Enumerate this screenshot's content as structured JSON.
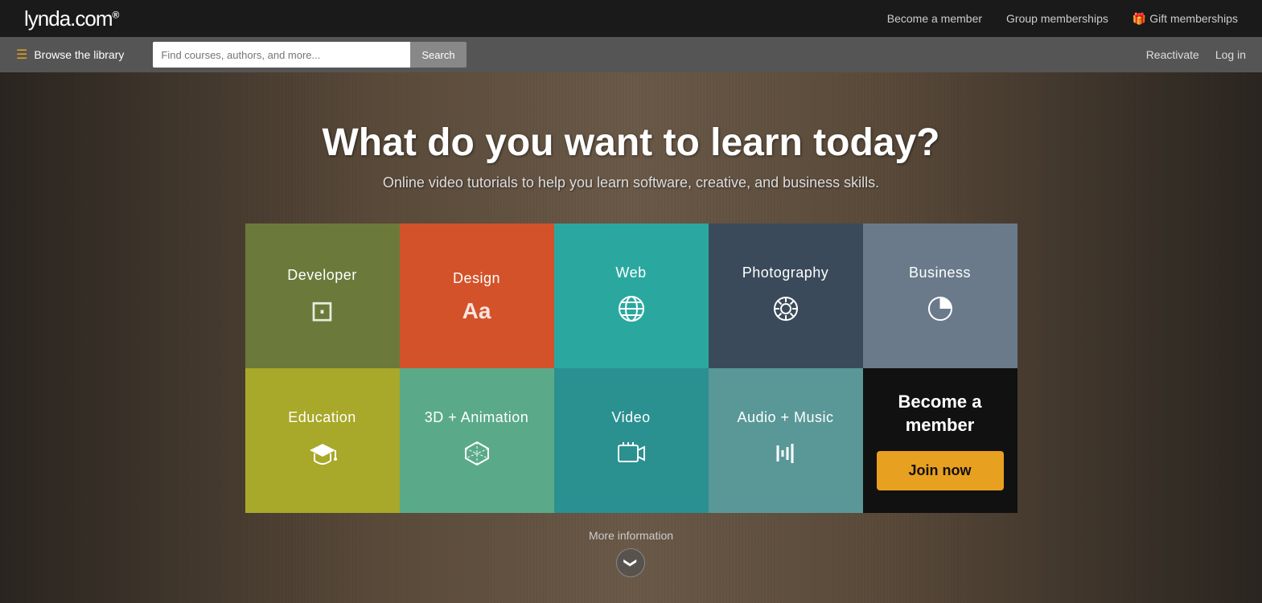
{
  "brand": {
    "name": "lynda",
    "tld": ".com",
    "trademark": "®"
  },
  "topnav": {
    "become_member": "Become a member",
    "group_memberships": "Group memberships",
    "gift_memberships": "Gift memberships",
    "gift_icon": "🎁"
  },
  "searchbar": {
    "browse_label": "Browse the library",
    "search_placeholder": "Find courses, authors, and more...",
    "search_button": "Search",
    "reactivate": "Reactivate",
    "login": "Log in"
  },
  "hero": {
    "title": "What do you want to learn today?",
    "subtitle": "Online video tutorials to help you learn software, creative, and business skills."
  },
  "categories": [
    {
      "id": "developer",
      "label": "Developer",
      "icon": "terminal",
      "color": "#6b7a3a"
    },
    {
      "id": "design",
      "label": "Design",
      "icon": "font",
      "color": "#d4522a"
    },
    {
      "id": "web",
      "label": "Web",
      "icon": "globe",
      "color": "#2aa8a0"
    },
    {
      "id": "photography",
      "label": "Photography",
      "icon": "aperture",
      "color": "#3a4a5a"
    },
    {
      "id": "business",
      "label": "Business",
      "icon": "pie",
      "color": "#6a7a8a"
    },
    {
      "id": "education",
      "label": "Education",
      "icon": "grad",
      "color": "#a8a82a"
    },
    {
      "id": "3d-animation",
      "label": "3D + Animation",
      "icon": "box",
      "color": "#5aaa8a"
    },
    {
      "id": "video",
      "label": "Video",
      "icon": "film",
      "color": "#2a9090"
    },
    {
      "id": "audio-music",
      "label": "Audio + Music",
      "icon": "audio",
      "color": "#5a9898"
    }
  ],
  "member_cta": {
    "heading": "Become a member",
    "join_label": "Join now"
  },
  "more_info": {
    "label": "More information",
    "chevron": "❯"
  }
}
